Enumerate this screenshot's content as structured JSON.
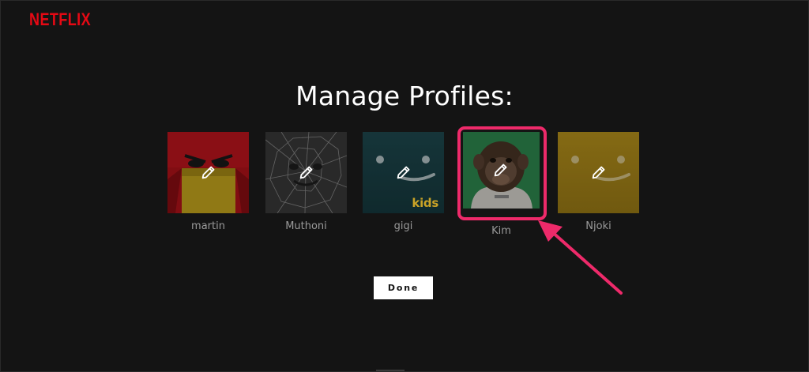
{
  "brand": {
    "logo_text": "NETFLIX",
    "color": "#e50914"
  },
  "page": {
    "title": "Manage Profiles:"
  },
  "profiles": [
    {
      "name": "martin",
      "avatar": "red-angry-face",
      "edit_icon": "pencil-icon"
    },
    {
      "name": "Muthoni",
      "avatar": "shattered-glass-face",
      "edit_icon": "pencil-icon"
    },
    {
      "name": "gigi",
      "avatar": "teal-smiley-face",
      "badge": "kids",
      "edit_icon": "pencil-icon"
    },
    {
      "name": "Kim",
      "avatar": "chimpanzee-astronaut",
      "edit_icon": "pencil-icon",
      "highlighted": true
    },
    {
      "name": "Njoki",
      "avatar": "yellow-smiley-face",
      "edit_icon": "pencil-icon"
    }
  ],
  "annotation": {
    "highlight_color": "#ee2a6a",
    "pointer": "arrow-pointing-to-kim"
  },
  "actions": {
    "done_label": "Done"
  }
}
